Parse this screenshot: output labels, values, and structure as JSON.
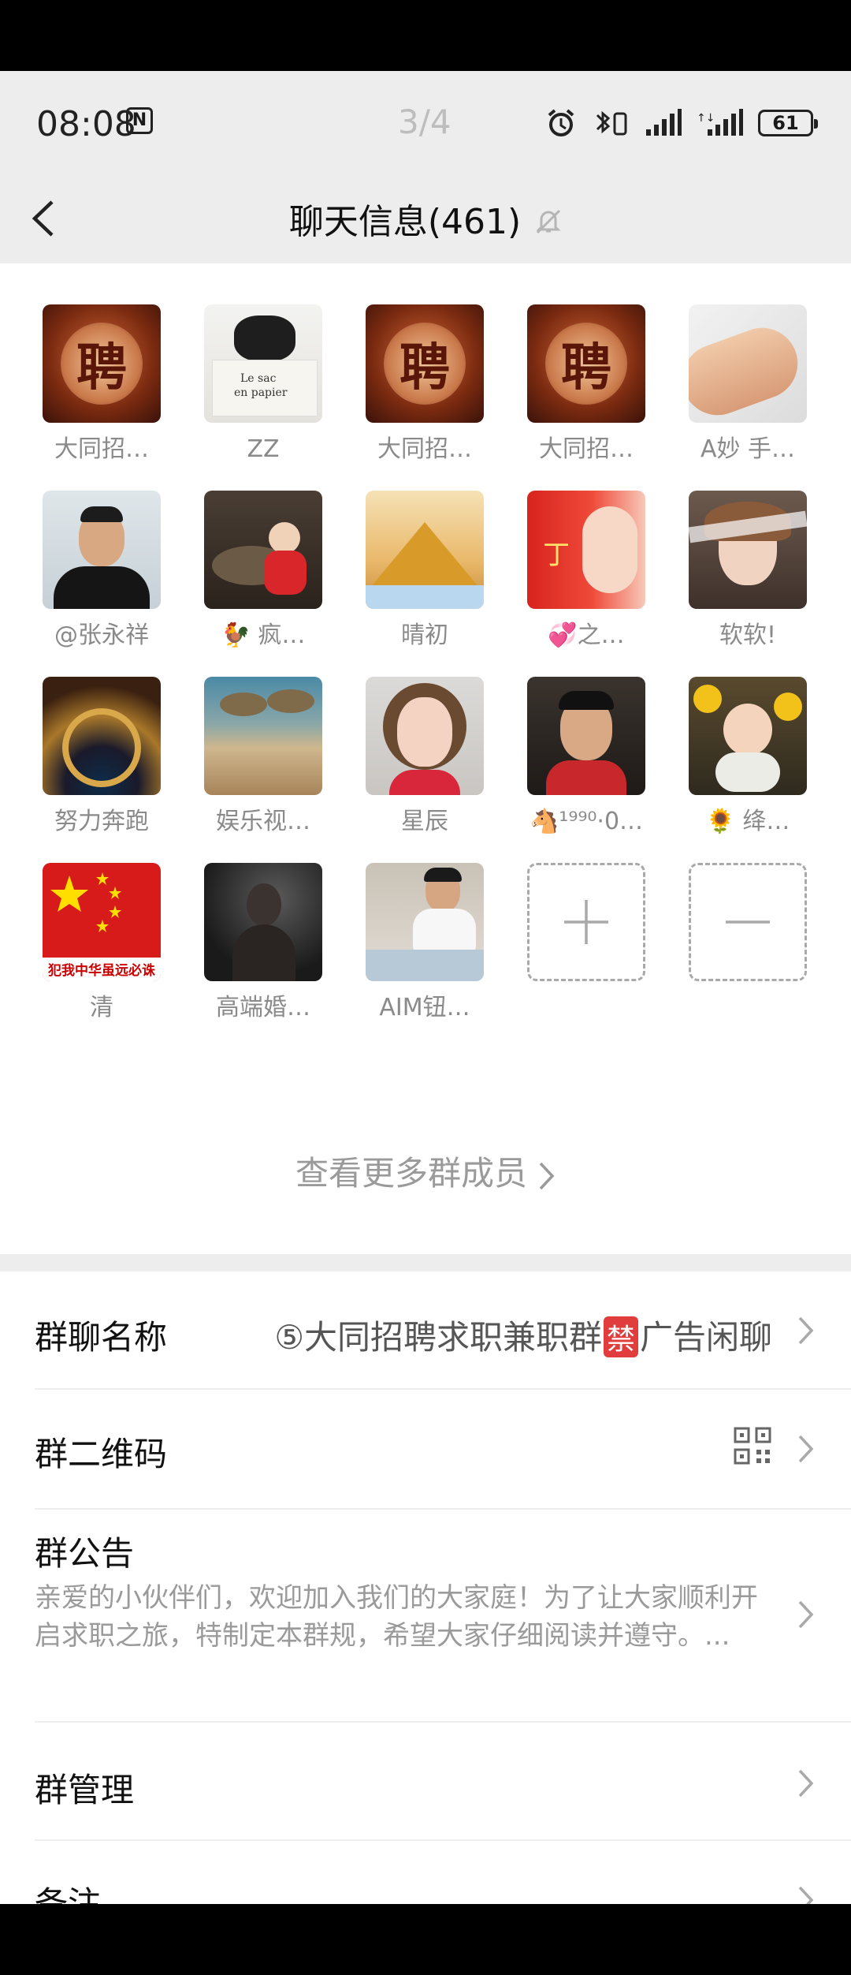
{
  "status": {
    "time": "08:08",
    "page": "3/4",
    "battery": "61"
  },
  "header": {
    "title": "聊天信息(461)"
  },
  "members": [
    {
      "name": "大同招…"
    },
    {
      "name": "ZZ"
    },
    {
      "name": "大同招…"
    },
    {
      "name": "大同招…"
    },
    {
      "name": "A妙 手…"
    },
    {
      "name": "@张永祥"
    },
    {
      "name": "🐓 疯…"
    },
    {
      "name": "晴初"
    },
    {
      "name": "💞之…"
    },
    {
      "name": "软软!"
    },
    {
      "name": "努力奔跑"
    },
    {
      "name": "娱乐视…"
    },
    {
      "name": "星辰"
    },
    {
      "name": "🐴¹⁹⁹⁰·0…"
    },
    {
      "name": "🌻 绛…"
    },
    {
      "name": "清"
    },
    {
      "name": "高端婚…"
    },
    {
      "name": "AIM钮…"
    }
  ],
  "avatar_text": {
    "pin_char": "聘",
    "zz_line1": "Le sac",
    "zz_line2": "en papier",
    "flag_banner": "犯我中华虽远必诛",
    "ding": "丁"
  },
  "more_members": "查看更多群成员",
  "settings": {
    "group_name_label": "群聊名称",
    "group_name_value_prefix": "⑤大同招聘求职兼职群",
    "group_name_value_badge": "禁",
    "group_name_value_suffix": "广告闲聊",
    "qr_label": "群二维码",
    "notice_label": "群公告",
    "notice_text": "亲爱的小伙伴们，欢迎加入我们的大家庭！为了让大家顺利开启求职之旅，特制定本群规，希望大家仔细阅读并遵守。...",
    "manage_label": "群管理",
    "remark_label": "备注"
  }
}
